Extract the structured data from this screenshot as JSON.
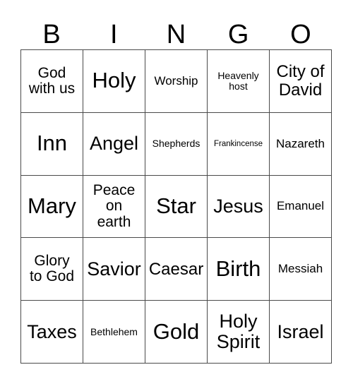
{
  "card": {
    "header_letters": [
      "B",
      "I",
      "N",
      "G",
      "O"
    ],
    "rows": [
      [
        {
          "text": "God\nwith us",
          "size": "md"
        },
        {
          "text": "Holy",
          "size": "xxl"
        },
        {
          "text": "Worship",
          "size": "sm"
        },
        {
          "text": "Heavenly\nhost",
          "size": "xs"
        },
        {
          "text": "City of\nDavid",
          "size": "lg"
        }
      ],
      [
        {
          "text": "Inn",
          "size": "xxl"
        },
        {
          "text": "Angel",
          "size": "xl"
        },
        {
          "text": "Shepherds",
          "size": "xs"
        },
        {
          "text": "Frankincense",
          "size": "xxs"
        },
        {
          "text": "Nazareth",
          "size": "sm"
        }
      ],
      [
        {
          "text": "Mary",
          "size": "xxl"
        },
        {
          "text": "Peace\non\nearth",
          "size": "md"
        },
        {
          "text": "Star",
          "size": "xxl"
        },
        {
          "text": "Jesus",
          "size": "xl"
        },
        {
          "text": "Emanuel",
          "size": "sm"
        }
      ],
      [
        {
          "text": "Glory\nto God",
          "size": "md"
        },
        {
          "text": "Savior",
          "size": "xl"
        },
        {
          "text": "Caesar",
          "size": "lg"
        },
        {
          "text": "Birth",
          "size": "xxl"
        },
        {
          "text": "Messiah",
          "size": "sm"
        }
      ],
      [
        {
          "text": "Taxes",
          "size": "xl"
        },
        {
          "text": "Bethlehem",
          "size": "xs"
        },
        {
          "text": "Gold",
          "size": "xxl"
        },
        {
          "text": "Holy\nSpirit",
          "size": "xl"
        },
        {
          "text": "Israel",
          "size": "xl"
        }
      ]
    ]
  },
  "colors": {
    "background": "#ffffff",
    "text": "#000000",
    "grid_line": "#4a4a4a"
  }
}
